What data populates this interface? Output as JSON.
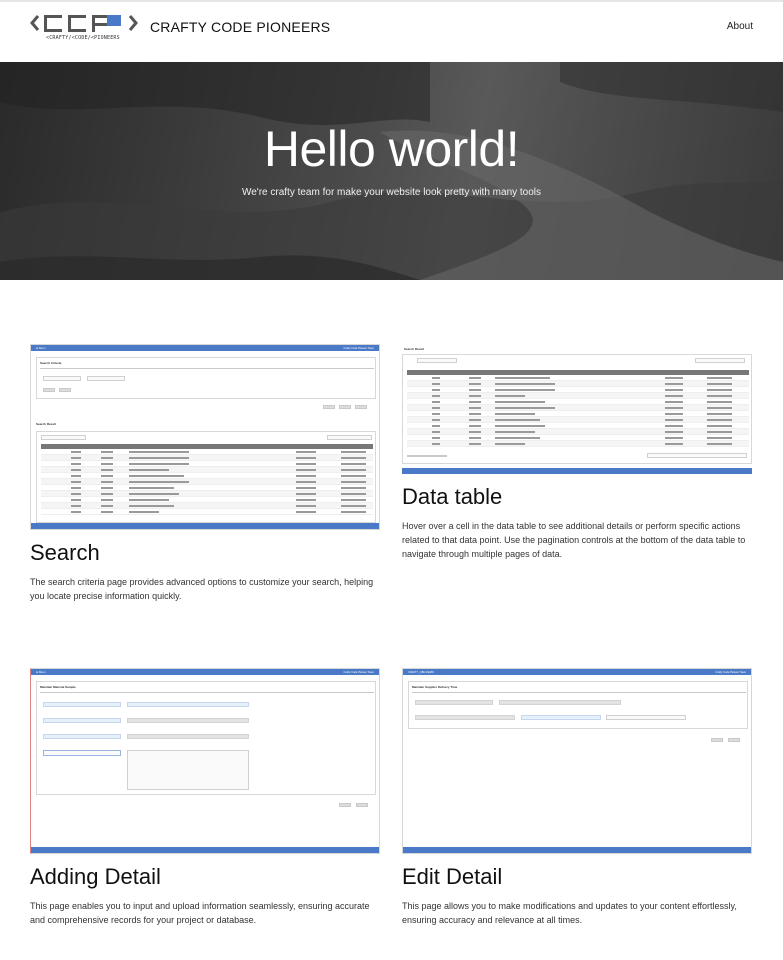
{
  "header": {
    "logo_sub": "<CRAFTY/<CODE/<PIONEERS",
    "brand": "CRAFTY CODE PIONEERS",
    "nav_about": "About"
  },
  "hero": {
    "title": "Hello world!",
    "subtitle": "We're crafty team for make your website look pretty with many tools"
  },
  "features": [
    {
      "title": "Search",
      "description": "The search criteria page provides advanced options to customize your search, helping you locate precise information quickly.",
      "screenshot_labels": {
        "section1": "Search Criteria",
        "section2": "Search Result"
      }
    },
    {
      "title": "Data table",
      "description": "Hover over a cell in the data table to see additional details or perform specific actions related to that data point. Use the pagination controls at the bottom of the data table to navigate through multiple pages of data.",
      "screenshot_labels": {
        "section1": "Search Result"
      }
    },
    {
      "title": "Adding Detail",
      "description": "This page enables you to input and upload information seamlessly, ensuring accurate and comprehensive records for your project or database.",
      "screenshot_labels": {
        "section1": "Maintain Material Sample"
      }
    },
    {
      "title": "Edit Detail",
      "description": "This page allows you to make modifications and updates to your content effortlessly, ensuring accuracy and relevance at all times.",
      "screenshot_labels": {
        "section1": "Maintain Supplier Delivery Time"
      }
    }
  ],
  "colors": {
    "accent": "#4a7ac7",
    "hero_dark": "#2a2a2a"
  }
}
